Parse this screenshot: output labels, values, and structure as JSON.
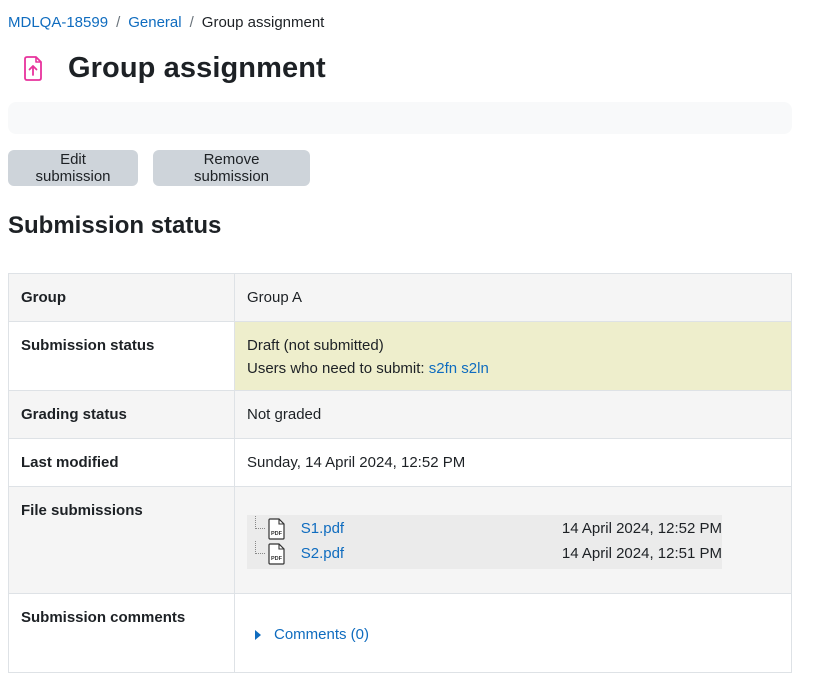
{
  "breadcrumb": {
    "items": [
      "MDLQA-18599",
      "General"
    ],
    "separator": "/",
    "current": "Group assignment"
  },
  "page": {
    "title": "Group assignment",
    "icon": "assignment-upload-icon",
    "accent_color": "#e8329c"
  },
  "buttons": {
    "edit": "Edit submission",
    "remove": "Remove submission"
  },
  "section_title": "Submission status",
  "table": {
    "group": {
      "label": "Group",
      "value": "Group A"
    },
    "submission_status": {
      "label": "Submission status",
      "value": "Draft (not submitted)",
      "users_prefix": "Users who need to submit: ",
      "users_link": "s2fn s2ln"
    },
    "grading_status": {
      "label": "Grading status",
      "value": "Not graded"
    },
    "last_modified": {
      "label": "Last modified",
      "value": "Sunday, 14 April 2024, 12:52 PM"
    },
    "file_submissions": {
      "label": "File submissions",
      "files": [
        {
          "name": "S1.pdf",
          "date": "14 April 2024, 12:52 PM",
          "icon": "pdf-file-icon"
        },
        {
          "name": "S2.pdf",
          "date": "14 April 2024, 12:51 PM",
          "icon": "pdf-file-icon"
        }
      ]
    },
    "submission_comments": {
      "label": "Submission comments",
      "link": "Comments (0)"
    }
  },
  "colors": {
    "link": "#0f6cbf",
    "draft_highlight": "#eeeecc",
    "button_bg": "#ced4da"
  }
}
